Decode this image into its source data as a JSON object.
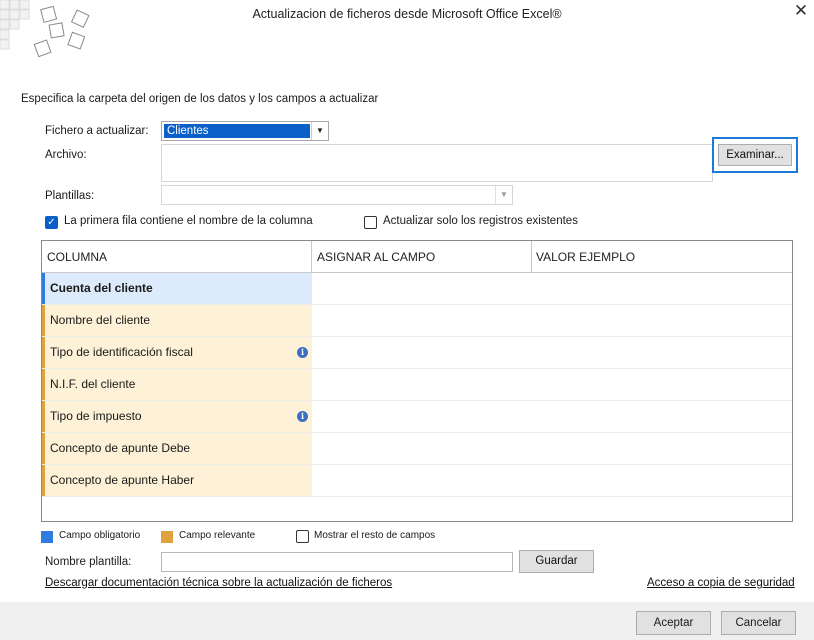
{
  "window": {
    "title": "Actualizacion de ficheros desde Microsoft Office Excel®",
    "close_symbol": "✕"
  },
  "section_label": "Especifica la carpeta del origen de los datos y los campos a actualizar",
  "fichero": {
    "label": "Fichero a actualizar:",
    "selected": "Clientes",
    "arrow": "▼"
  },
  "archivo": {
    "label": "Archivo:",
    "value": "",
    "button": "Examinar..."
  },
  "plantillas": {
    "label": "Plantillas:",
    "value": "",
    "arrow": "▼"
  },
  "options": {
    "first_row_header": {
      "label": "La primera fila contiene el nombre de la columna",
      "checked": true,
      "mark": "✓"
    },
    "only_existing": {
      "label": "Actualizar solo los registros existentes",
      "checked": false
    }
  },
  "grid": {
    "headers": [
      "COLUMNA",
      "ASIGNAR AL CAMPO",
      "VALOR EJEMPLO"
    ],
    "rows": [
      {
        "columna": "Cuenta del cliente",
        "kind": "obligatorio",
        "info": false
      },
      {
        "columna": "Nombre del cliente",
        "kind": "relevante",
        "info": false
      },
      {
        "columna": "Tipo de identificación fiscal",
        "kind": "relevante",
        "info": true
      },
      {
        "columna": "N.I.F. del cliente",
        "kind": "relevante",
        "info": false
      },
      {
        "columna": "Tipo de impuesto",
        "kind": "relevante",
        "info": true
      },
      {
        "columna": "Concepto de apunte Debe",
        "kind": "relevante",
        "info": false
      },
      {
        "columna": "Concepto de apunte Haber",
        "kind": "relevante",
        "info": false
      }
    ],
    "info_glyph": "i"
  },
  "legend": {
    "obligatorio": {
      "label": "Campo obligatorio",
      "color": "#2f7be0"
    },
    "relevante": {
      "label": "Campo relevante",
      "color": "#e0a23d"
    },
    "mostrar_resto": {
      "label": "Mostrar el resto de campos",
      "checked": false
    }
  },
  "nombre_plantilla": {
    "label": "Nombre plantilla:",
    "value": "",
    "button": "Guardar"
  },
  "links": {
    "doc": "Descargar documentación técnica sobre la actualización de ficheros",
    "backup": "Acceso a copia de seguridad"
  },
  "footer": {
    "accept": "Aceptar",
    "cancel": "Cancelar"
  },
  "colors": {
    "selection": "#0a5fc9",
    "focus_border": "#1e7ad9",
    "required_fill": "#dceafb",
    "relevant_fill": "#fdf1d8"
  }
}
